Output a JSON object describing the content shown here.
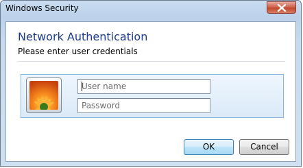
{
  "window": {
    "title": "Windows Security"
  },
  "dialog": {
    "heading": "Network Authentication",
    "subheading": "Please enter user credentials"
  },
  "credentials": {
    "username_placeholder": "User name",
    "username_value": "",
    "password_placeholder": "Password",
    "password_value": ""
  },
  "buttons": {
    "ok_label": "OK",
    "cancel_label": "Cancel"
  },
  "icons": {
    "close": "close-icon",
    "user_tile": "flower-user-icon"
  },
  "colors": {
    "heading": "#1e3c8c",
    "close_button": "#c04a30",
    "ok_button_accent": "#3c7fb1"
  }
}
